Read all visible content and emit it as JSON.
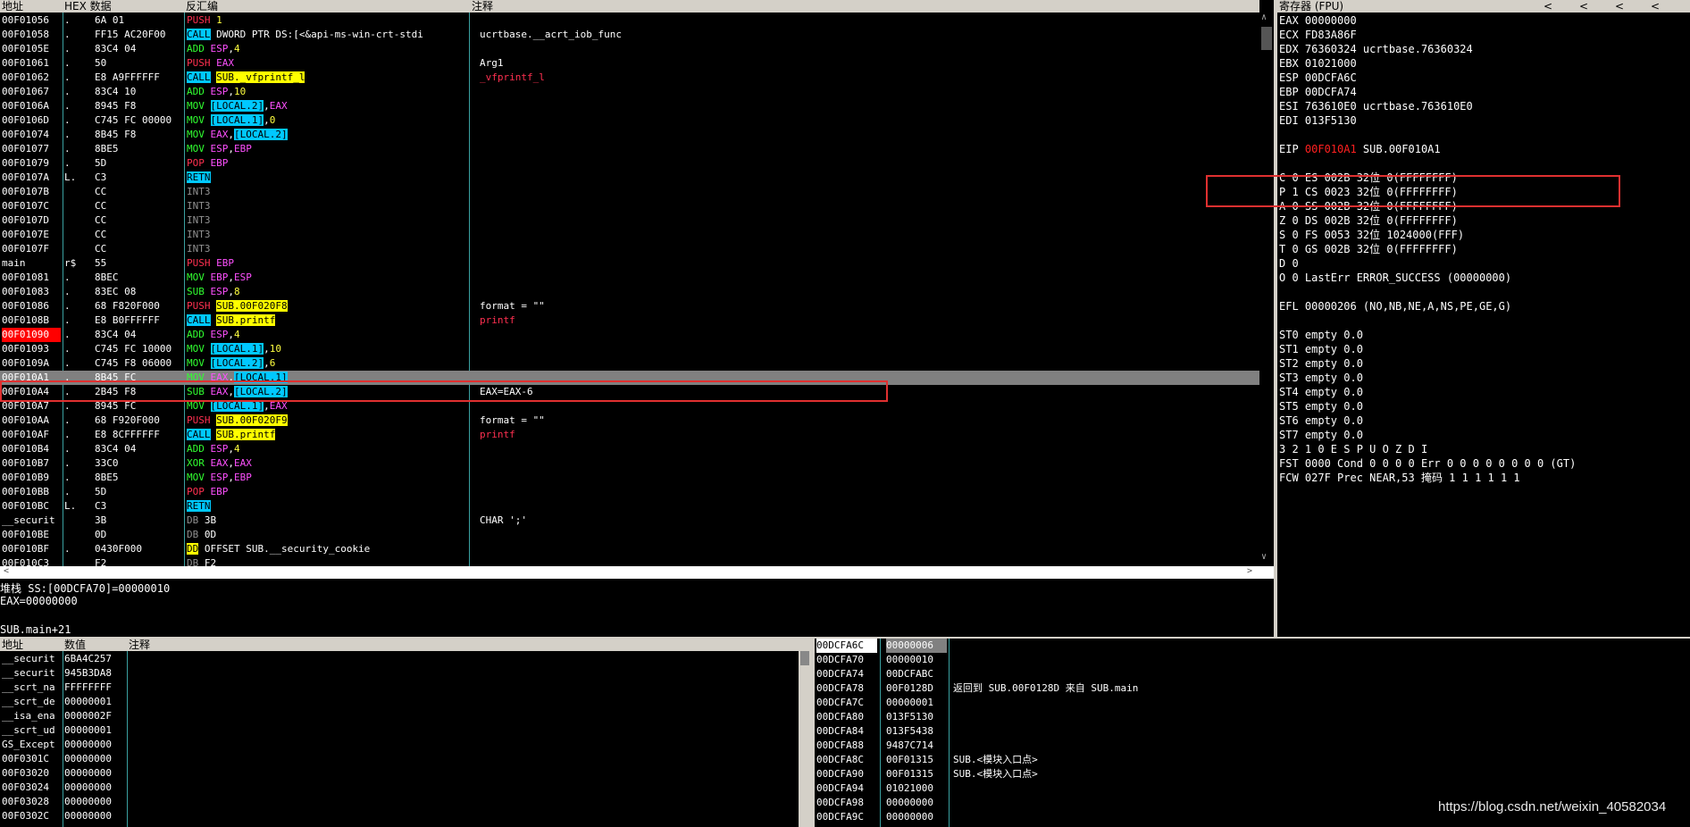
{
  "headers": {
    "address": "地址",
    "hex": "HEX 数据",
    "disasm": "反汇编",
    "comment": "注释",
    "registers": "寄存器 (FPU)",
    "reg_nav": [
      "<",
      "<",
      "<",
      "<"
    ],
    "dump_address": "地址",
    "dump_value": "数值",
    "dump_comment": "注释"
  },
  "disasm_rows": [
    {
      "addr": "00F01056",
      "mark": ".",
      "hex": "6A 01",
      "mn": "PUSH",
      "ops": [
        {
          "t": "1",
          "k": "num"
        }
      ],
      "cmt": ""
    },
    {
      "addr": "00F01058",
      "mark": ".",
      "hex": "FF15 AC20F00",
      "mn": "CALL",
      "ops": [
        {
          "t": "DWORD PTR DS:[<&api-ms-win-crt-stdi",
          "k": "plain"
        }
      ],
      "cmt": "ucrtbase.__acrt_iob_func"
    },
    {
      "addr": "00F0105E",
      "mark": ".",
      "hex": "83C4 04",
      "mn": "ADD",
      "ops": [
        {
          "t": "ESP",
          "k": "reg"
        },
        {
          "t": ",",
          "k": "plain"
        },
        {
          "t": "4",
          "k": "num"
        }
      ],
      "cmt": ""
    },
    {
      "addr": "00F01061",
      "mark": ".",
      "hex": "50",
      "mn": "PUSH",
      "ops": [
        {
          "t": "EAX",
          "k": "reg"
        }
      ],
      "cmt": "Arg1"
    },
    {
      "addr": "00F01062",
      "mark": ".",
      "hex": "E8 A9FFFFFF",
      "mn": "CALL",
      "ops": [
        {
          "t": "SUB._vfprintf_l",
          "k": "sub"
        }
      ],
      "cmt": "_vfprintf_l",
      "cmt_red": true
    },
    {
      "addr": "00F01067",
      "mark": ".",
      "hex": "83C4 10",
      "mn": "ADD",
      "ops": [
        {
          "t": "ESP",
          "k": "reg"
        },
        {
          "t": ",",
          "k": "plain"
        },
        {
          "t": "10",
          "k": "num"
        }
      ],
      "cmt": ""
    },
    {
      "addr": "00F0106A",
      "mark": ".",
      "hex": "8945 F8",
      "mn": "MOV",
      "ops": [
        {
          "t": "[LOCAL.2]",
          "k": "mem"
        },
        {
          "t": ",",
          "k": "plain"
        },
        {
          "t": "EAX",
          "k": "reg"
        }
      ],
      "cmt": ""
    },
    {
      "addr": "00F0106D",
      "mark": ".",
      "hex": "C745 FC 00000",
      "mn": "MOV",
      "ops": [
        {
          "t": "[LOCAL.1]",
          "k": "mem"
        },
        {
          "t": ",",
          "k": "plain"
        },
        {
          "t": "0",
          "k": "num"
        }
      ],
      "cmt": ""
    },
    {
      "addr": "00F01074",
      "mark": ".",
      "hex": "8B45 F8",
      "mn": "MOV",
      "ops": [
        {
          "t": "EAX",
          "k": "reg"
        },
        {
          "t": ",",
          "k": "plain"
        },
        {
          "t": "[LOCAL.2]",
          "k": "mem"
        }
      ],
      "cmt": ""
    },
    {
      "addr": "00F01077",
      "mark": ".",
      "hex": "8BE5",
      "mn": "MOV",
      "ops": [
        {
          "t": "ESP",
          "k": "reg"
        },
        {
          "t": ",",
          "k": "plain"
        },
        {
          "t": "EBP",
          "k": "reg"
        }
      ],
      "cmt": ""
    },
    {
      "addr": "00F01079",
      "mark": ".",
      "hex": "5D",
      "mn": "POP",
      "ops": [
        {
          "t": "EBP",
          "k": "reg"
        }
      ],
      "cmt": ""
    },
    {
      "addr": "00F0107A",
      "mark": "L.",
      "hex": "C3",
      "mn": "RETN",
      "ops": [],
      "cmt": ""
    },
    {
      "addr": "00F0107B",
      "mark": "",
      "hex": "CC",
      "mn": "INT3",
      "ops": [],
      "cmt": ""
    },
    {
      "addr": "00F0107C",
      "mark": "",
      "hex": "CC",
      "mn": "INT3",
      "ops": [],
      "cmt": ""
    },
    {
      "addr": "00F0107D",
      "mark": "",
      "hex": "CC",
      "mn": "INT3",
      "ops": [],
      "cmt": ""
    },
    {
      "addr": "00F0107E",
      "mark": "",
      "hex": "CC",
      "mn": "INT3",
      "ops": [],
      "cmt": ""
    },
    {
      "addr": "00F0107F",
      "mark": "",
      "hex": "CC",
      "mn": "INT3",
      "ops": [],
      "cmt": ""
    },
    {
      "addr": "main",
      "mark": "r$",
      "hex": "55",
      "mn": "PUSH",
      "ops": [
        {
          "t": "EBP",
          "k": "reg"
        }
      ],
      "cmt": ""
    },
    {
      "addr": "00F01081",
      "mark": ".",
      "hex": "8BEC",
      "mn": "MOV",
      "ops": [
        {
          "t": "EBP",
          "k": "reg"
        },
        {
          "t": ",",
          "k": "plain"
        },
        {
          "t": "ESP",
          "k": "reg"
        }
      ],
      "cmt": ""
    },
    {
      "addr": "00F01083",
      "mark": ".",
      "hex": "83EC 08",
      "mn": "SUB",
      "ops": [
        {
          "t": "ESP",
          "k": "reg"
        },
        {
          "t": ",",
          "k": "plain"
        },
        {
          "t": "8",
          "k": "num"
        }
      ],
      "cmt": ""
    },
    {
      "addr": "00F01086",
      "mark": ".",
      "hex": "68 F820F000",
      "mn": "PUSH",
      "ops": [
        {
          "t": "SUB.00F020F8",
          "k": "sub"
        }
      ],
      "cmt": "format = \"\""
    },
    {
      "addr": "00F0108B",
      "mark": ".",
      "hex": "E8 B0FFFFFF",
      "mn": "CALL",
      "ops": [
        {
          "t": "SUB.printf",
          "k": "sub"
        }
      ],
      "cmt": "printf",
      "cmt_red": true
    },
    {
      "addr": "00F01090",
      "mark": ".",
      "hex": "83C4 04",
      "mn": "ADD",
      "ops": [
        {
          "t": "ESP",
          "k": "reg"
        },
        {
          "t": ",",
          "k": "plain"
        },
        {
          "t": "4",
          "k": "num"
        }
      ],
      "cmt": "",
      "addr_red": true
    },
    {
      "addr": "00F01093",
      "mark": ".",
      "hex": "C745 FC 10000",
      "mn": "MOV",
      "ops": [
        {
          "t": "[LOCAL.1]",
          "k": "mem"
        },
        {
          "t": ",",
          "k": "plain"
        },
        {
          "t": "10",
          "k": "num"
        }
      ],
      "cmt": ""
    },
    {
      "addr": "00F0109A",
      "mark": ".",
      "hex": "C745 F8 06000",
      "mn": "MOV",
      "ops": [
        {
          "t": "[LOCAL.2]",
          "k": "mem"
        },
        {
          "t": ",",
          "k": "plain"
        },
        {
          "t": "6",
          "k": "num"
        }
      ],
      "cmt": ""
    },
    {
      "addr": "00F010A1",
      "mark": ".",
      "hex": "8B45 FC",
      "mn": "MOV",
      "ops": [
        {
          "t": "EAX",
          "k": "reg"
        },
        {
          "t": ",",
          "k": "plain"
        },
        {
          "t": "[LOCAL.1]",
          "k": "mem"
        }
      ],
      "cmt": "",
      "selected": true
    },
    {
      "addr": "00F010A4",
      "mark": ".",
      "hex": "2B45 F8",
      "mn": "SUB",
      "ops": [
        {
          "t": "EAX",
          "k": "reg"
        },
        {
          "t": ",",
          "k": "plain"
        },
        {
          "t": "[LOCAL.2]",
          "k": "mem"
        }
      ],
      "cmt": "EAX=EAX-6"
    },
    {
      "addr": "00F010A7",
      "mark": ".",
      "hex": "8945 FC",
      "mn": "MOV",
      "ops": [
        {
          "t": "[LOCAL.1]",
          "k": "mem"
        },
        {
          "t": ",",
          "k": "plain"
        },
        {
          "t": "EAX",
          "k": "reg"
        }
      ],
      "cmt": ""
    },
    {
      "addr": "00F010AA",
      "mark": ".",
      "hex": "68 F920F000",
      "mn": "PUSH",
      "ops": [
        {
          "t": "SUB.00F020F9",
          "k": "sub"
        }
      ],
      "cmt": "format = \"\""
    },
    {
      "addr": "00F010AF",
      "mark": ".",
      "hex": "E8 8CFFFFFF",
      "mn": "CALL",
      "ops": [
        {
          "t": "SUB.printf",
          "k": "sub"
        }
      ],
      "cmt": "printf",
      "cmt_red": true
    },
    {
      "addr": "00F010B4",
      "mark": ".",
      "hex": "83C4 04",
      "mn": "ADD",
      "ops": [
        {
          "t": "ESP",
          "k": "reg"
        },
        {
          "t": ",",
          "k": "plain"
        },
        {
          "t": "4",
          "k": "num"
        }
      ],
      "cmt": ""
    },
    {
      "addr": "00F010B7",
      "mark": ".",
      "hex": "33C0",
      "mn": "XOR",
      "ops": [
        {
          "t": "EAX",
          "k": "reg"
        },
        {
          "t": ",",
          "k": "plain"
        },
        {
          "t": "EAX",
          "k": "reg"
        }
      ],
      "cmt": ""
    },
    {
      "addr": "00F010B9",
      "mark": ".",
      "hex": "8BE5",
      "mn": "MOV",
      "ops": [
        {
          "t": "ESP",
          "k": "reg"
        },
        {
          "t": ",",
          "k": "plain"
        },
        {
          "t": "EBP",
          "k": "reg"
        }
      ],
      "cmt": ""
    },
    {
      "addr": "00F010BB",
      "mark": ".",
      "hex": "5D",
      "mn": "POP",
      "ops": [
        {
          "t": "EBP",
          "k": "reg"
        }
      ],
      "cmt": ""
    },
    {
      "addr": "00F010BC",
      "mark": "L.",
      "hex": "C3",
      "mn": "RETN",
      "ops": [],
      "cmt": ""
    },
    {
      "addr": "__securit",
      "mark": "",
      "hex": "3B",
      "mn": "DB",
      "ops": [
        {
          "t": "3B",
          "k": "plain"
        }
      ],
      "cmt": "CHAR ';'"
    },
    {
      "addr": "00F010BE",
      "mark": "",
      "hex": "0D",
      "mn": "DB",
      "ops": [
        {
          "t": "0D",
          "k": "plain"
        }
      ],
      "cmt": ""
    },
    {
      "addr": "00F010BF",
      "mark": ".",
      "hex": "0430F000",
      "mn": "DD",
      "ops": [
        {
          "t": "OFFSET SUB.__security_cookie",
          "k": "plain"
        }
      ],
      "cmt": ""
    },
    {
      "addr": "00F010C3",
      "mark": "",
      "hex": "F2",
      "mn": "DB",
      "ops": [
        {
          "t": "F2",
          "k": "plain"
        }
      ],
      "cmt": ""
    }
  ],
  "info": {
    "line1": "堆栈 SS:[00DCFA70]=00000010",
    "line2": "EAX=00000000",
    "line3": "SUB.main+21"
  },
  "registers": [
    {
      "text": "EAX 00000000"
    },
    {
      "text": "ECX FD83A86F"
    },
    {
      "text": "EDX 76360324 ucrtbase.76360324"
    },
    {
      "text": "EBX 01021000"
    },
    {
      "text": "ESP 00DCFA6C"
    },
    {
      "text": "EBP 00DCFA74"
    },
    {
      "text": "ESI 763610E0 ucrtbase.763610E0"
    },
    {
      "text": "EDI 013F5130"
    },
    {
      "text": ""
    },
    {
      "eip_label": "EIP ",
      "eip_val": "00F010A1",
      "eip_rest": " SUB.00F010A1"
    },
    {
      "text": ""
    },
    {
      "text": "C 0  ES 002B 32位 0(FFFFFFFF)"
    },
    {
      "text": "P 1  CS 0023 32位 0(FFFFFFFF)"
    },
    {
      "text": "A 0  SS 002B 32位 0(FFFFFFFF)"
    },
    {
      "text": "Z 0  DS 002B 32位 0(FFFFFFFF)"
    },
    {
      "text": "S 0  FS 0053 32位 1024000(FFF)"
    },
    {
      "text": "T 0  GS 002B 32位 0(FFFFFFFF)"
    },
    {
      "text": "D 0"
    },
    {
      "text": "O 0  LastErr ERROR_SUCCESS (00000000)"
    },
    {
      "text": ""
    },
    {
      "text": "EFL 00000206 (NO,NB,NE,A,NS,PE,GE,G)"
    },
    {
      "text": ""
    },
    {
      "text": "ST0 empty 0.0"
    },
    {
      "text": "ST1 empty 0.0"
    },
    {
      "text": "ST2 empty 0.0"
    },
    {
      "text": "ST3 empty 0.0"
    },
    {
      "text": "ST4 empty 0.0"
    },
    {
      "text": "ST5 empty 0.0"
    },
    {
      "text": "ST6 empty 0.0"
    },
    {
      "text": "ST7 empty 0.0"
    },
    {
      "text": "               3 2 1 0      E S P U O Z D I"
    },
    {
      "text": "FST 0000  Cond 0 0 0 0  Err 0 0 0 0 0 0 0 0  (GT)"
    },
    {
      "text": "FCW 027F  Prec NEAR,53  掩码    1 1 1 1 1 1"
    }
  ],
  "dump_rows": [
    {
      "addr": "__securit",
      "val": "6BA4C257"
    },
    {
      "addr": "__securit",
      "val": "945B3DA8"
    },
    {
      "addr": "__scrt_na",
      "val": "FFFFFFFF"
    },
    {
      "addr": "__scrt_de",
      "val": "00000001"
    },
    {
      "addr": "__isa_ena",
      "val": "0000002F"
    },
    {
      "addr": "__scrt_ud",
      "val": "00000001"
    },
    {
      "addr": "GS_Except",
      "val": "00000000"
    },
    {
      "addr": "00F0301C",
      "val": "00000000"
    },
    {
      "addr": "00F03020",
      "val": "00000000"
    },
    {
      "addr": "00F03024",
      "val": "00000000"
    },
    {
      "addr": "00F03028",
      "val": "00000000"
    },
    {
      "addr": "00F0302C",
      "val": "00000000"
    }
  ],
  "stack_rows": [
    {
      "addr": "00DCFA6C",
      "val": "00000006",
      "cmt": "",
      "hl": true
    },
    {
      "addr": "00DCFA70",
      "val": "00000010",
      "cmt": ""
    },
    {
      "addr": "00DCFA74",
      "val": "00DCFABC",
      "cmt": ""
    },
    {
      "addr": "00DCFA78",
      "val": "00F0128D",
      "cmt": "返回到 SUB.00F0128D 来自 SUB.main"
    },
    {
      "addr": "00DCFA7C",
      "val": "00000001",
      "cmt": ""
    },
    {
      "addr": "00DCFA80",
      "val": "013F5130",
      "cmt": ""
    },
    {
      "addr": "00DCFA84",
      "val": "013F5438",
      "cmt": ""
    },
    {
      "addr": "00DCFA88",
      "val": "9487C714",
      "cmt": ""
    },
    {
      "addr": "00DCFA8C",
      "val": "00F01315",
      "cmt": "SUB.<模块入口点>"
    },
    {
      "addr": "00DCFA90",
      "val": "00F01315",
      "cmt": "SUB.<模块入口点>"
    },
    {
      "addr": "00DCFA94",
      "val": "01021000",
      "cmt": ""
    },
    {
      "addr": "00DCFA98",
      "val": "00000000",
      "cmt": ""
    },
    {
      "addr": "00DCFA9C",
      "val": "00000000",
      "cmt": ""
    }
  ],
  "watermark": "https://blog.csdn.net/weixin_40582034"
}
